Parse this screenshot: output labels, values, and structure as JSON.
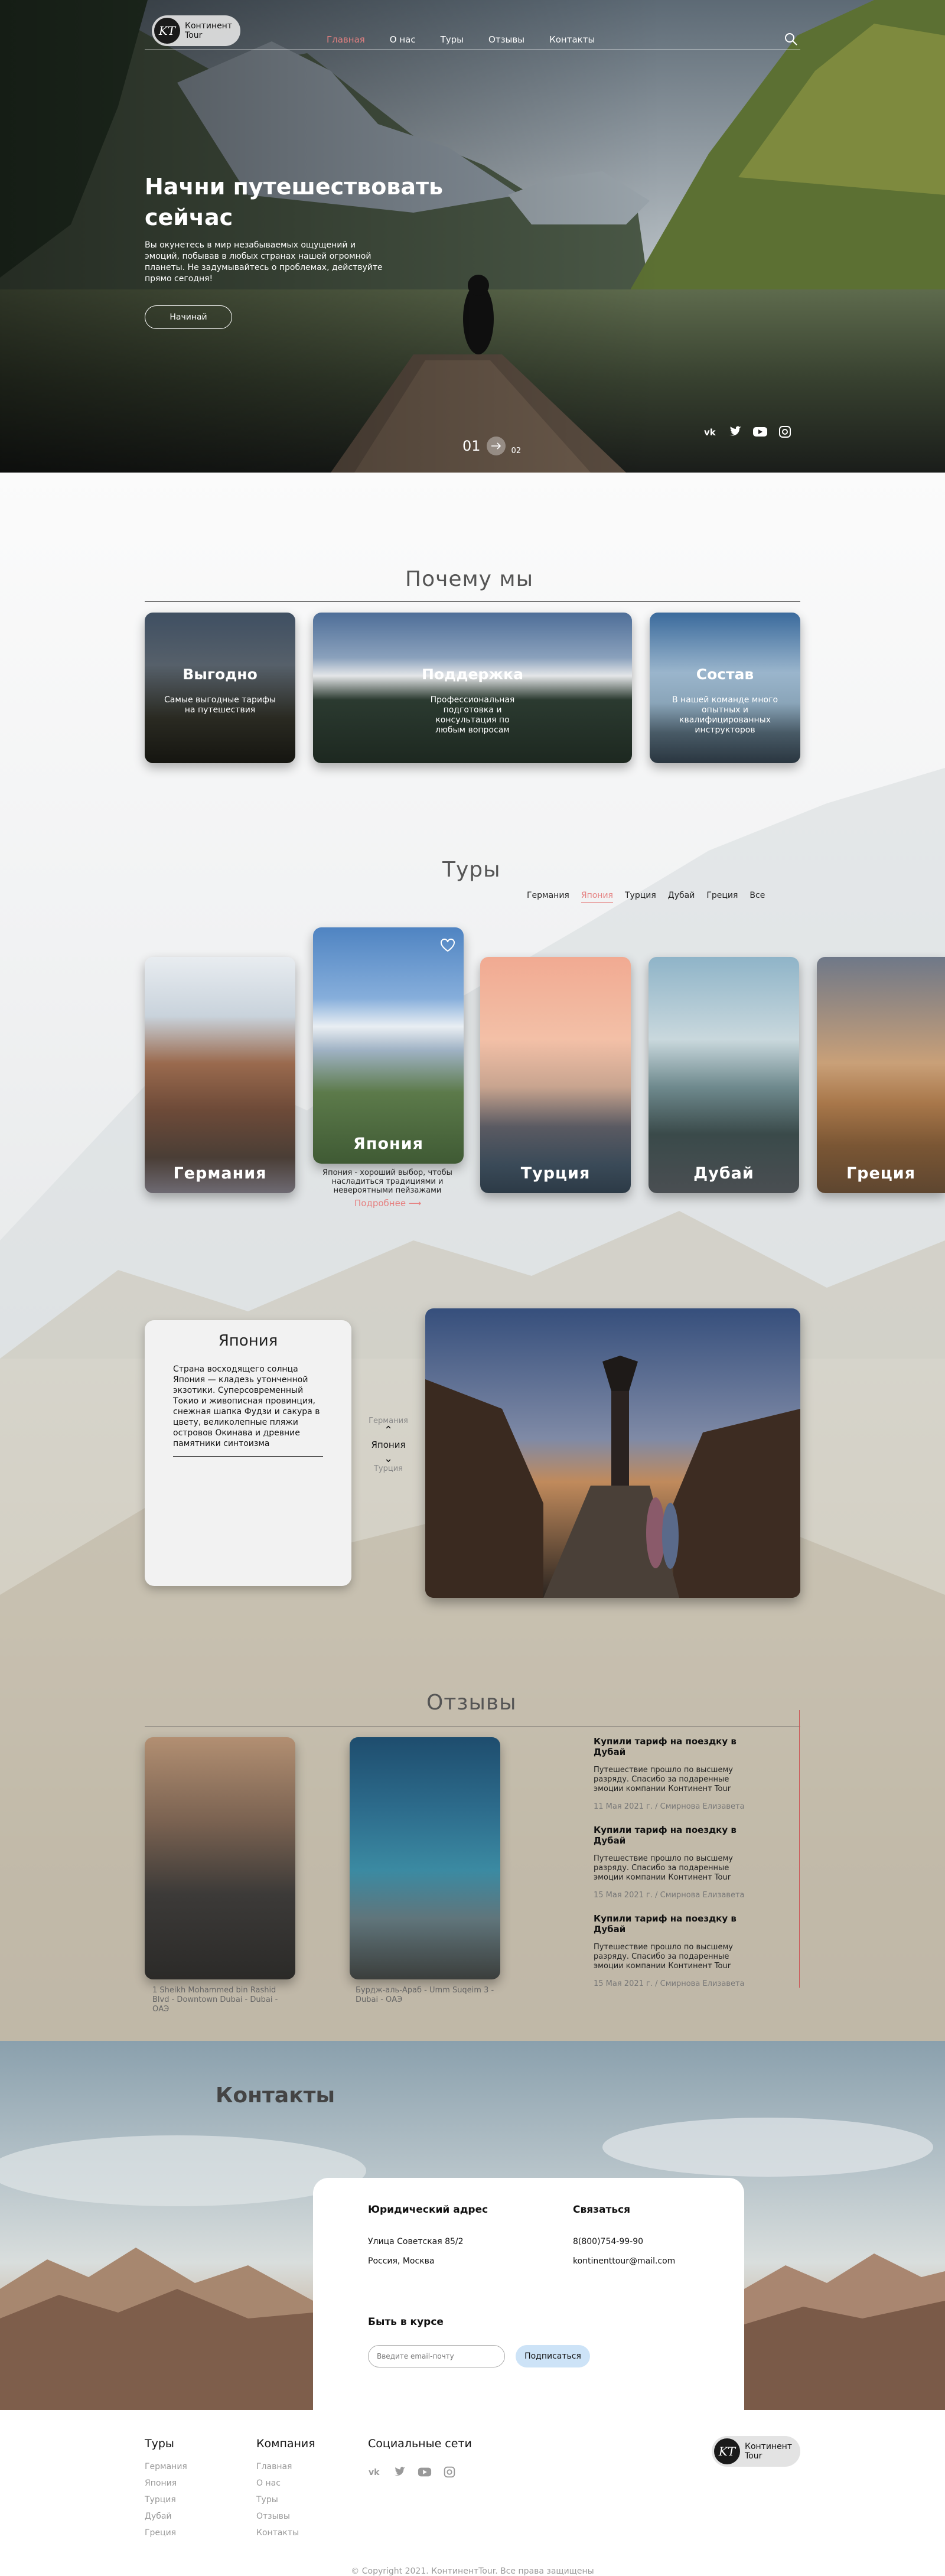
{
  "header": {
    "logo_mark": "KT",
    "logo_line1": "Континент",
    "logo_line2": "Tour",
    "menu": [
      "Главная",
      "О нас",
      "Туры",
      "Отзывы",
      "Контакты"
    ],
    "active_menu": "Главная"
  },
  "hero": {
    "title": "Начни путешествовать сейчас",
    "text": "Вы окунетесь в мир незабываемых ощущений и эмоций, побывав в любых странах нашей огромной планеты. Не задумывайтесь о проблемах, действуйте прямо сегодня!",
    "button": "Начинай",
    "slide_current": "01",
    "slide_next": "02",
    "socials": [
      "vk-icon",
      "twitter-icon",
      "youtube-icon",
      "instagram-icon"
    ]
  },
  "why": {
    "title": "Почему мы",
    "cards": [
      {
        "title": "Выгодно",
        "text": "Самые выгодные тарифы на путешествия"
      },
      {
        "title": "Поддержка",
        "text": "Профессиональная подготовка и консультация по любым вопросам"
      },
      {
        "title": "Состав",
        "text": "В нашей команде много опытных и квалифицированных инструкторов"
      }
    ]
  },
  "tours": {
    "title": "Туры",
    "tabs": [
      "Германия",
      "Япония",
      "Турция",
      "Дубай",
      "Греция",
      "Все"
    ],
    "active_tab": "Япония",
    "cards": [
      "Германия",
      "Япония",
      "Турция",
      "Дубай",
      "Греция"
    ],
    "featured_desc": "Япония - хороший выбор, чтобы насладиться традициями и невероятными пейзажами",
    "more": "Подробнее ⟶"
  },
  "country": {
    "title": "Япония",
    "text": "Страна восходящего солнца Япония — кладезь утонченной экзотики. Суперсовременный Токио и живописная провинция, снежная шапка Фудзи и сакура в цвету, великолепные пляжи островов Окинава и древние памятники синтоизма",
    "prev": "Германия",
    "current": "Япония",
    "next": "Турция"
  },
  "reviews": {
    "title": "Отзывы",
    "photos": [
      {
        "caption": "1 Sheikh Mohammed bin Rashid Blvd - Downtown Dubai - Dubai - ОАЭ"
      },
      {
        "caption": "Бурдж-аль-Араб - Umm Suqeim 3 - Dubai - ОАЭ"
      }
    ],
    "items": [
      {
        "title": "Купили  тариф на поездку в Дубай",
        "body": "Путешествие прошло по высшему разряду. Спасибо за подаренные эмоции компании Континент Tour",
        "meta": "11 Мая 2021 г. / Смирнова Елизавета"
      },
      {
        "title": "Купили  тариф на поездку в Дубай",
        "body": "Путешествие прошло по высшему разряду. Спасибо за подаренные эмоции компании Континент Tour",
        "meta": "15 Мая 2021 г. / Смирнова Елизавета"
      },
      {
        "title": "Купили  тариф на поездку в Дубай",
        "body": "Путешествие прошло по высшему разряду. Спасибо за подаренные эмоции компании Континент Tour",
        "meta": "15 Мая 2021 г. / Смирнова Елизавета"
      }
    ]
  },
  "contacts": {
    "title": "Контакты",
    "legal_title": "Юридический адрес",
    "address1": "Улица Советская 85/2",
    "address2": "Россия, Москва",
    "contact_title": "Связаться",
    "phone": "8(800)754-99-90",
    "email": "kontinenttour@mail.com",
    "news_title": "Быть в курсе",
    "email_placeholder": "Введите email-почту",
    "subscribe": "Подписаться"
  },
  "footer": {
    "tours_title": "Туры",
    "tours": [
      "Германия",
      "Япония",
      "Турция",
      "Дубай",
      "Греция"
    ],
    "company_title": "Компания",
    "company": [
      "Главная",
      "О нас",
      "Туры",
      "Отзывы",
      "Контакты"
    ],
    "social_title": "Социальные сети",
    "copyright": "© Copyright 2021. КонтинентTour. Все права защищены"
  }
}
